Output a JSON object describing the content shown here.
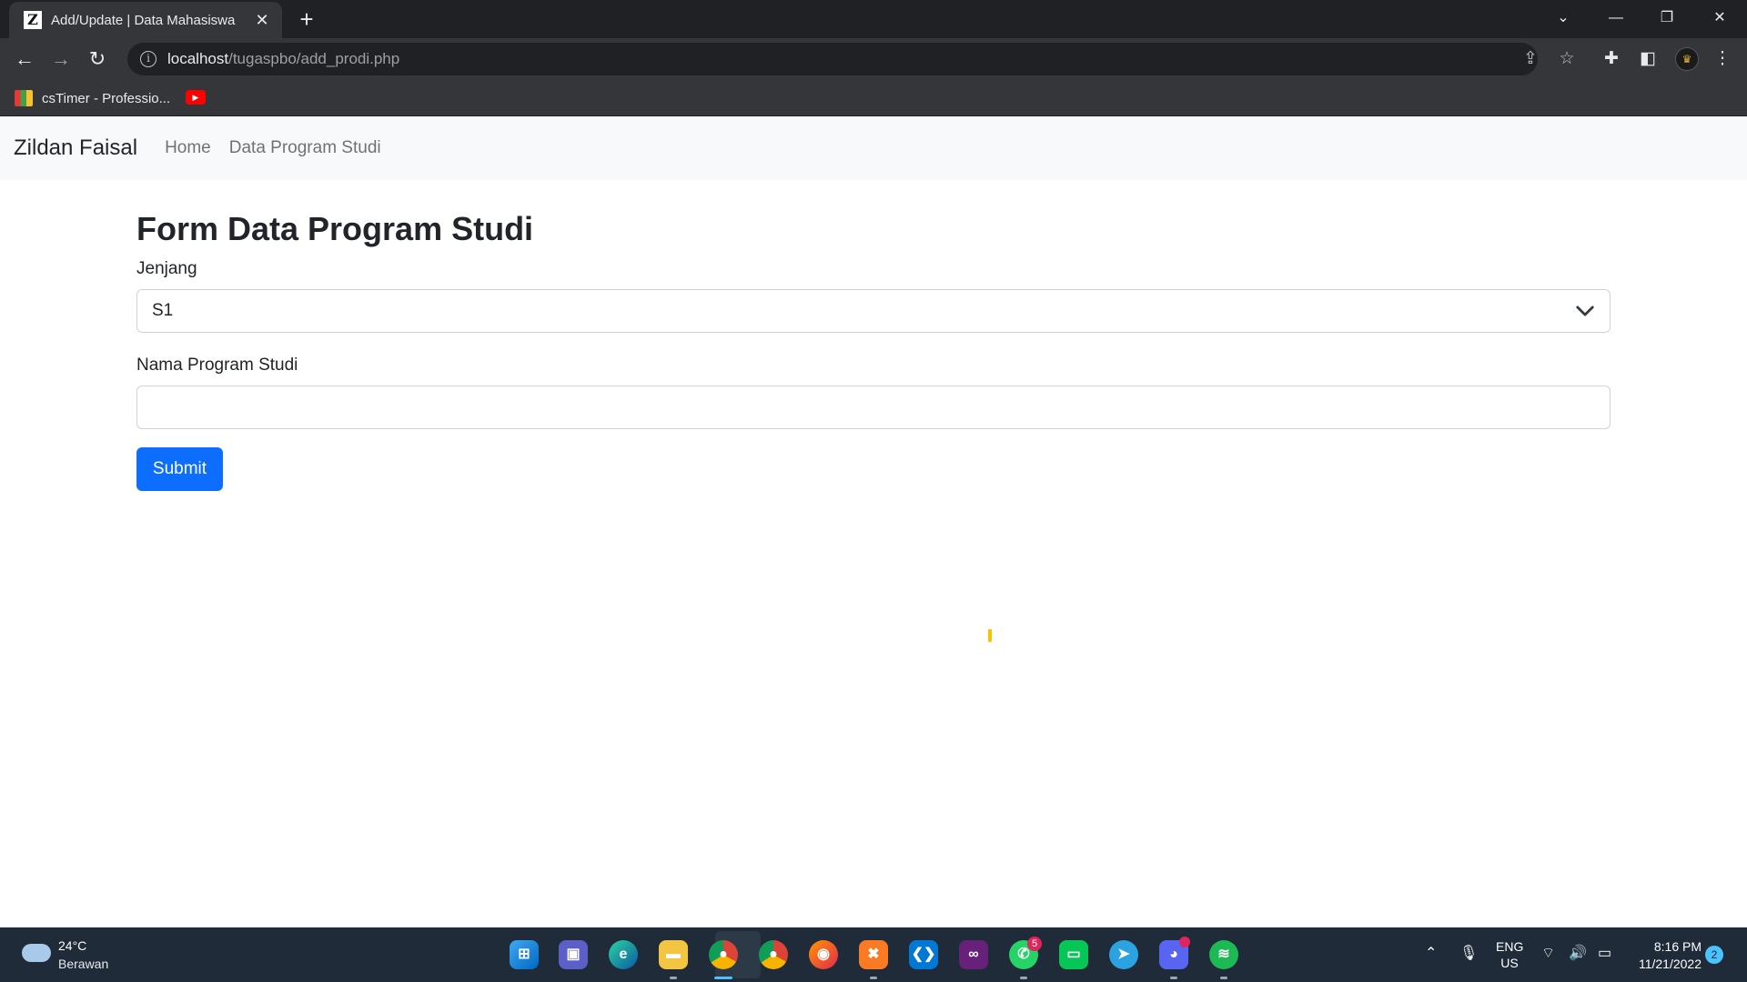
{
  "browser": {
    "tab_title": "Add/Update | Data Mahasiswa",
    "tab_favicon_letter": "Z",
    "url_host": "localhost",
    "url_path": "/tugaspbo/add_prodi.php",
    "bookmarks": [
      {
        "label": "csTimer - Professio..."
      }
    ]
  },
  "navbar": {
    "brand": "Zildan Faisal",
    "links": [
      "Home",
      "Data Program Studi"
    ]
  },
  "form": {
    "title": "Form Data Program Studi",
    "jenjang_label": "Jenjang",
    "jenjang_value": "S1",
    "nama_label": "Nama Program Studi",
    "nama_value": "",
    "submit_label": "Submit"
  },
  "taskbar": {
    "weather_temp": "24°C",
    "weather_desc": "Berawan",
    "whatsapp_badge": "5",
    "lang_line1": "ENG",
    "lang_line2": "US",
    "time": "8:16 PM",
    "date": "11/21/2022",
    "notification_count": "2"
  },
  "colors": {
    "primary": "#0d6efd",
    "navbar_bg": "#f8f9fa",
    "chrome_dark": "#202124",
    "taskbar_bg": "#1f2b38"
  }
}
